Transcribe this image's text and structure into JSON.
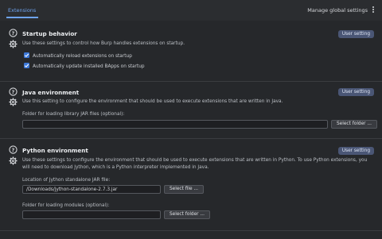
{
  "header": {
    "tab_label": "Extensions",
    "manage_label": "Manage global settings"
  },
  "startup": {
    "title": "Startup behavior",
    "badge": "User setting",
    "description": "Use these settings to control how Burp handles extensions on startup.",
    "checkboxes": [
      {
        "label": "Automatically reload extensions on startup",
        "checked": true
      },
      {
        "label": "Automatically update installed BApps on startup",
        "checked": true
      }
    ]
  },
  "java": {
    "title": "Java environment",
    "badge": "User setting",
    "description": "Use this setting to configure the environment that should be used to execute extensions that are written in Java.",
    "folder_label": "Folder for loading library JAR files (optional):",
    "folder_value": "",
    "select_folder_label": "Select folder ..."
  },
  "python": {
    "title": "Python environment",
    "badge": "User setting",
    "description": "Use these settings to configure the environment that should be used to execute extensions that are written in Python. To use Python extensions, you will need to download Jython, which is a Python interpreter implemented in Java.",
    "jar_label": "Location of Jython standalone JAR file:",
    "jar_value": "/Downloads/jython-standalone-2.7.3.jar",
    "select_file_label": "Select file ...",
    "modules_label": "Folder for loading modules (optional):",
    "modules_value": "",
    "select_folder_label": "Select folder ..."
  },
  "colors": {
    "accent": "#6ea3ef",
    "badge_bg": "#4a5675",
    "checkbox": "#3c78d8",
    "background": "#26282b"
  }
}
